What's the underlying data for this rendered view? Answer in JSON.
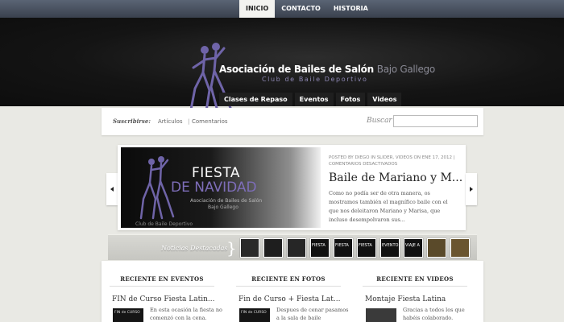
{
  "top_nav": {
    "items": [
      "INICIO",
      "CONTACTO",
      "HISTORIA"
    ],
    "active": "INICIO"
  },
  "header": {
    "title_main": "Asociación de Bailes de Salón",
    "title_sub": "Bajo Gallego",
    "tagline": "Club de Baile Deportivo"
  },
  "main_nav": {
    "items": [
      "Clases de Repaso",
      "Eventos",
      "Fotos",
      "Videos"
    ]
  },
  "subscribe": {
    "label": "Suscribirse:",
    "articles": "Artículos",
    "separator": "|",
    "comments": "Comentarios",
    "search_label": "Buscar",
    "search_value": ""
  },
  "slider": {
    "image_line1": "FIESTA",
    "image_line2": "DE NAVIDAD",
    "image_line3": "Asociación de Bailes de Salón",
    "image_line4": "Bajo Gallego",
    "image_line5": "Club de Baile Deportivo",
    "meta": "POSTED BY DIEGO IN SLIDER, VIDEOS ON ENE 17, 2012 | COMENTARIOS DESACTIVADOS",
    "title": "Baile de Mariano y M...",
    "excerpt": "Como no podía ser de otra manera, os mostramos también el magnífico baile con el que nos deleitaron Mariano y Marisa, que incluso desempolvaron sus..."
  },
  "featured": {
    "label": "Noticias Destacadas",
    "thumbs": [
      {
        "text": "",
        "color": "#2a2a2a"
      },
      {
        "text": "",
        "color": "#1e1e1e"
      },
      {
        "text": "",
        "color": "#262626"
      },
      {
        "text": "FIESTA",
        "color": "#111111"
      },
      {
        "text": "FIESTA",
        "color": "#111111"
      },
      {
        "text": "FIESTA",
        "color": "#111111"
      },
      {
        "text": "EVENTO",
        "color": "#111111"
      },
      {
        "text": "VIAJE A",
        "color": "#111111"
      },
      {
        "text": "",
        "color": "#5a4a2a"
      },
      {
        "text": "",
        "color": "#6a5530"
      }
    ]
  },
  "columns": [
    {
      "heading": "RECIENTE EN EVENTOS",
      "title": "FIN de Curso Fiesta Latin...",
      "thumb_text": "FIN de CURSO",
      "excerpt": "En esta ocasión la fiesta no comenzó con la cena."
    },
    {
      "heading": "RECIENTE EN FOTOS",
      "title": "Fin de Curso + Fiesta Lat...",
      "thumb_text": "FIN de CURSO",
      "excerpt": "Despues de cenar pasamos a la sala de baile"
    },
    {
      "heading": "RECIENTE EN VIDEOS",
      "title": "Montaje Fiesta Latina",
      "thumb_text": "",
      "excerpt": "Gracias a todos los que habéis colaborado."
    }
  ],
  "colors": {
    "accent_purple": "#7d6db8",
    "nav_bar": "#3a414e",
    "page_bg": "#e9e9e4"
  }
}
